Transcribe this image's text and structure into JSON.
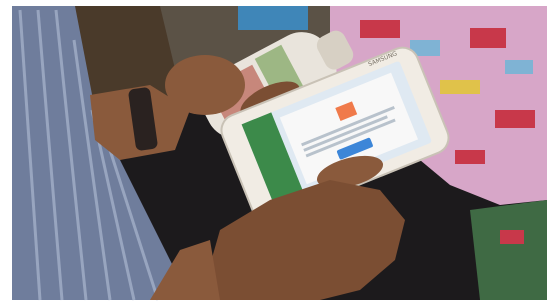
{
  "photo": {
    "colors": {
      "background_white": "#ffffff",
      "shirt_blue": "#6f7d9c",
      "shirt_stripe": "#aab6cf",
      "skin": "#8a5a3c",
      "skin_dark": "#5e3a24",
      "bottle": "#e9e4dc",
      "phone_body": "#f1ece4",
      "phone_screen": "#dfe9f2",
      "dialog_orange": "#f07a4a",
      "fabric_pink": "#d7a6c8",
      "fabric_red": "#c8384a",
      "dark_floor": "#1c1a1c"
    },
    "phone": {
      "brand": "SAMSUNG"
    }
  }
}
